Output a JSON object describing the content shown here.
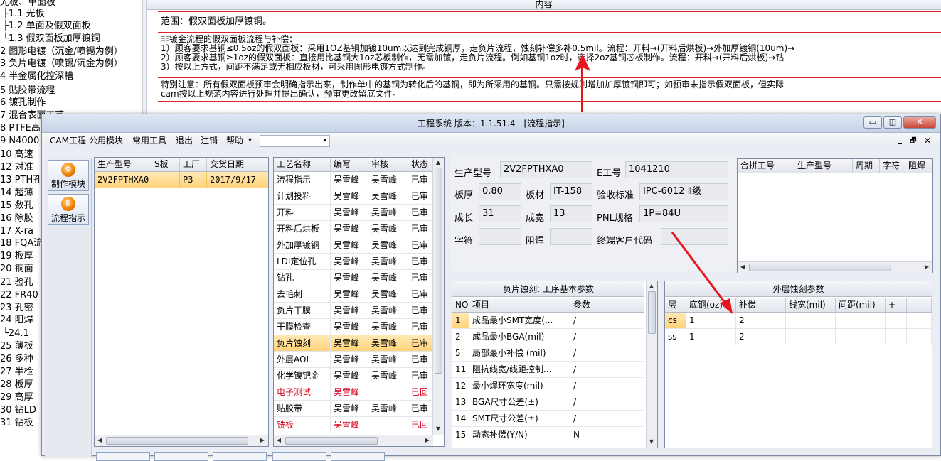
{
  "background": {
    "tree": [
      {
        "text": "光板、单面板"
      },
      {
        "text": "├1.1 光板"
      },
      {
        "text": "├1.2 单面及假双面板"
      },
      {
        "text": "└1.3 假双面板加厚镀铜"
      },
      {
        "text": "2 图形电镀（沉金/喷锡为例）"
      },
      {
        "text": "3 负片电镀（喷锡/沉金为例）"
      },
      {
        "text": "4 半金属化控深槽"
      },
      {
        "text": "5 贴胶带流程"
      },
      {
        "text": "6 镀孔制作"
      },
      {
        "text": "7 混合表面工艺"
      },
      {
        "text": "8 PTFE高"
      },
      {
        "text": "9 N4000"
      },
      {
        "text": "10 高速"
      },
      {
        "text": "12 对准"
      },
      {
        "text": "13 PTH孔"
      },
      {
        "text": "14 超薄"
      },
      {
        "text": "15 数孔"
      },
      {
        "text": "16 除胶"
      },
      {
        "text": "17 X-ra"
      },
      {
        "text": "18 FQA流"
      },
      {
        "text": "19 板厚"
      },
      {
        "text": "20 铜面"
      },
      {
        "text": "21 验孔"
      },
      {
        "text": "22 FR40"
      },
      {
        "text": "23 孔密"
      },
      {
        "text": "24 阻焊"
      },
      {
        "text": "└24.1"
      },
      {
        "text": "25 薄板"
      },
      {
        "text": "26 多种"
      },
      {
        "text": "27 半检"
      },
      {
        "text": "28 板厚"
      },
      {
        "text": "29 高厚"
      },
      {
        "text": "30 钻LD"
      },
      {
        "text": "31 钻板"
      }
    ],
    "header": "内容",
    "scope": "范围：假双面板加厚镀铜。",
    "process_lines": [
      "非镀金流程的假双面板流程与补偿：",
      "1）顾客要求基铜≤0.5oz的假双面板：采用1OZ基铜加镀10um以达到完成铜厚，走负片流程，蚀刻补偿多补0.5mil。流程：开料→(开料后烘板)→外加厚镀铜(10um)→",
      "2）顾客要求基铜≥1oz的假双面板：直接用比基铜大1oz芯板制作，无需加镀，走负片流程。例如基铜1oz时，选择2oz基铜芯板制作。流程：开料→(开料后烘板)→钻",
      "3）按以上方式，间距不满足或无相应板材，可采用图形电镀方式制作。"
    ],
    "notice_lines": [
      "特别注意：所有假双面板预审会明确指示出来，制作单中的基铜为转化后的基铜，即为所采用的基铜。只需按规则增加加厚镀铜即可；如预审未指示假双面板，但实际",
      "cam按以上规范内容进行处理并提出确认，预审更改留底文件。"
    ]
  },
  "window": {
    "title": "工程系统  版本：1.1.51.4 - [流程指示]",
    "menu": [
      "CAM工程",
      "公用模块",
      "常用工具",
      "退出",
      "注销",
      "帮助"
    ],
    "help_arrow": "▾",
    "combo_arrow": "▾",
    "controls": {
      "minimize": "▭",
      "restore": "◫",
      "close": "✕"
    },
    "mdi_controls": {
      "minimize": "_",
      "restore": "🗗",
      "close": "✕"
    }
  },
  "left_buttons": [
    {
      "label": "制作模块",
      "icon": "orange-gear-icon"
    },
    {
      "label": "流程指示",
      "icon": "orange-circle-icon"
    }
  ],
  "orders": {
    "columns": [
      "生产型号",
      "S板",
      "工厂",
      "交货日期"
    ],
    "rows": [
      [
        "2V2FPTHXA0",
        "",
        "P3",
        "2017/9/17"
      ]
    ]
  },
  "process": {
    "columns": [
      "工艺名称",
      "编写",
      "审核",
      "状态"
    ],
    "rows": [
      {
        "name": "流程指示",
        "writer": "吴雪峰",
        "reviewer": "吴雪峰",
        "status": "已审",
        "red": false
      },
      {
        "name": "计划投料",
        "writer": "吴雪峰",
        "reviewer": "吴雪峰",
        "status": "已审",
        "red": false
      },
      {
        "name": "开料",
        "writer": "吴雪峰",
        "reviewer": "吴雪峰",
        "status": "已审",
        "red": false
      },
      {
        "name": "开料后烘板",
        "writer": "吴雪峰",
        "reviewer": "吴雪峰",
        "status": "已审",
        "red": false
      },
      {
        "name": "外加厚镀铜",
        "writer": "吴雪峰",
        "reviewer": "吴雪峰",
        "status": "已审",
        "red": false
      },
      {
        "name": "LDI定位孔",
        "writer": "吴雪峰",
        "reviewer": "吴雪峰",
        "status": "已审",
        "red": false
      },
      {
        "name": "钻孔",
        "writer": "吴雪峰",
        "reviewer": "吴雪峰",
        "status": "已审",
        "red": false
      },
      {
        "name": "去毛刺",
        "writer": "吴雪峰",
        "reviewer": "吴雪峰",
        "status": "已审",
        "red": false
      },
      {
        "name": "负片干膜",
        "writer": "吴雪峰",
        "reviewer": "吴雪峰",
        "status": "已审",
        "red": false
      },
      {
        "name": "干膜检查",
        "writer": "吴雪峰",
        "reviewer": "吴雪峰",
        "status": "已审",
        "red": false
      },
      {
        "name": "负片蚀刻",
        "writer": "吴雪峰",
        "reviewer": "吴雪峰",
        "status": "已审",
        "red": false
      },
      {
        "name": "外层AOI",
        "writer": "吴雪峰",
        "reviewer": "吴雪峰",
        "status": "已审",
        "red": false
      },
      {
        "name": "化学镍钯金",
        "writer": "吴雪峰",
        "reviewer": "吴雪峰",
        "status": "已审",
        "red": false
      },
      {
        "name": "电子测试",
        "writer": "吴雪峰",
        "reviewer": "",
        "status": "已回",
        "red": true
      },
      {
        "name": "贴胶带",
        "writer": "吴雪峰",
        "reviewer": "吴雪峰",
        "status": "已审",
        "red": false
      },
      {
        "name": "铣板",
        "writer": "吴雪峰",
        "reviewer": "",
        "status": "已回",
        "red": true
      }
    ],
    "selected_index": 10
  },
  "params": {
    "model_label": "生产型号",
    "model": "2V2FPTHXA0",
    "eno_label": "E工号",
    "eno": "1041210",
    "thickness_label": "板厚",
    "thickness": "0.80",
    "material_label": "板材",
    "material": "IT-158",
    "standard_label": "验收标准",
    "standard": "IPC-6012 Ⅱ级",
    "length_label": "成长",
    "length": "31",
    "width_label": "成宽",
    "width": "13",
    "pnl_label": "PNL规格",
    "pnl": "1P=84U",
    "char_label": "字符",
    "char": "",
    "mask_label": "阻焊",
    "mask": "",
    "customer_label": "终端客户代码",
    "customer": ""
  },
  "combined": {
    "columns": [
      "合拼工号",
      "生产型号",
      "周期",
      "字符",
      "阻焊"
    ]
  },
  "etch_basic": {
    "title": "负片蚀刻: 工序基本参数",
    "columns": [
      "NO",
      "项目",
      "参数"
    ],
    "rows": [
      [
        "1",
        "成品最小SMT宽度(...",
        "/"
      ],
      [
        "2",
        "成品最小BGA(mil)",
        "/"
      ],
      [
        "5",
        "局部最小补偿 (mil)",
        "/"
      ],
      [
        "11",
        "阻抗线宽/线距控制...",
        "/"
      ],
      [
        "12",
        "最小焊环宽度(mil)",
        "/"
      ],
      [
        "13",
        "BGA尺寸公差(±)",
        "/"
      ],
      [
        "14",
        "SMT尺寸公差(±)",
        "/"
      ],
      [
        "15",
        "动态补偿(Y/N)",
        "N"
      ]
    ]
  },
  "outer_etch": {
    "title": "外层蚀刻参数",
    "columns": [
      "层",
      "底铜(oz)",
      "补偿",
      "线宽(mil)",
      "间距(mil)",
      "+",
      "-"
    ],
    "rows": [
      [
        "cs",
        "1",
        "2",
        "",
        "",
        "",
        ""
      ],
      [
        "ss",
        "1",
        "2",
        "",
        "",
        "",
        ""
      ]
    ]
  },
  "colors": {
    "accent": "#e8141c",
    "selection": "#ffd37a",
    "title_bg": "#c6d3e7"
  }
}
